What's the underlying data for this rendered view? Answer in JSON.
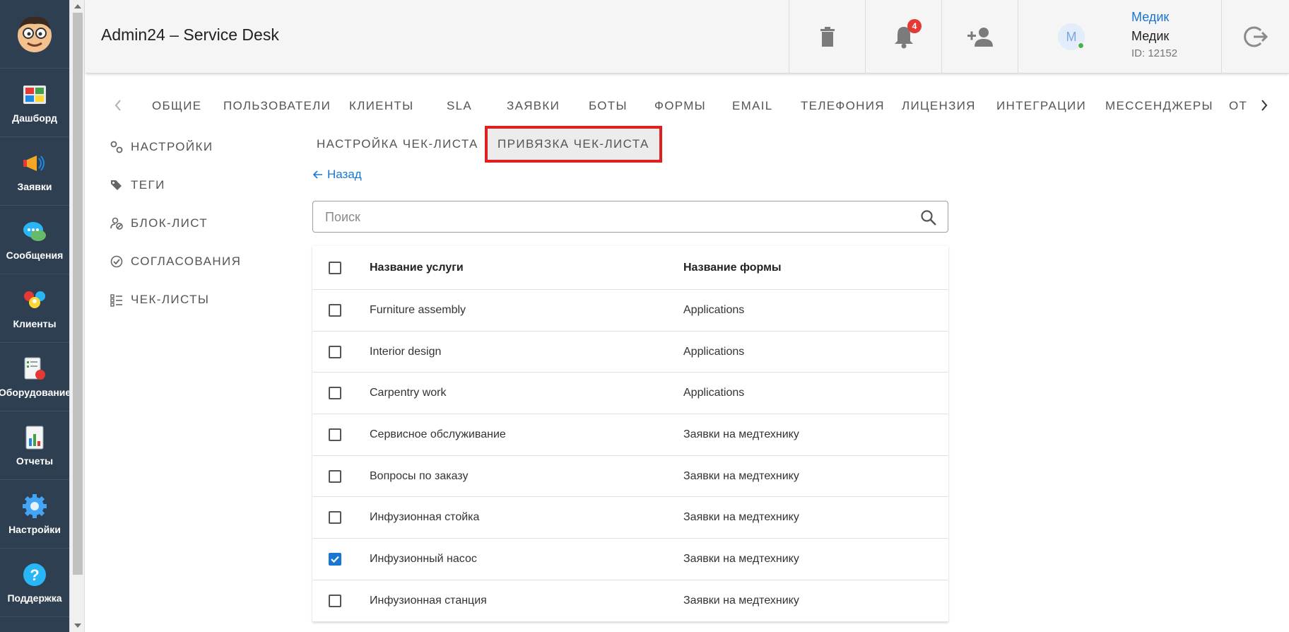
{
  "sidebar": {
    "logo": "avatar-logo",
    "items": [
      {
        "label": "Дашборд",
        "icon": "dashboard-icon"
      },
      {
        "label": "Заявки",
        "icon": "megaphone-icon"
      },
      {
        "label": "Сообщения",
        "icon": "chat-icon"
      },
      {
        "label": "Клиенты",
        "icon": "clients-icon"
      },
      {
        "label": "Оборудование",
        "icon": "equipment-icon"
      },
      {
        "label": "Отчеты",
        "icon": "reports-icon"
      },
      {
        "label": "Настройки",
        "icon": "gear-icon"
      },
      {
        "label": "Поддержка",
        "icon": "help-icon"
      }
    ]
  },
  "header": {
    "title": "Admin24 – Service Desk",
    "notifications_count": "4",
    "avatar_initial": "М",
    "user_link": "Медик",
    "user_name": "Медик",
    "user_id": "ID: 12152"
  },
  "top_tabs": [
    "ОБЩИЕ",
    "ПОЛЬЗОВАТЕЛИ",
    "КЛИЕНТЫ",
    "SLA",
    "ЗАЯВКИ",
    "БОТЫ",
    "ФОРМЫ",
    "EMAIL",
    "ТЕЛЕФОНИЯ",
    "ЛИЦЕНЗИЯ",
    "ИНТЕГРАЦИИ",
    "МЕССЕНДЖЕРЫ",
    "ОТ"
  ],
  "settings_nav": [
    {
      "label": "НАСТРОЙКИ",
      "icon": "settings-cog-icon"
    },
    {
      "label": "ТЕГИ",
      "icon": "tag-icon"
    },
    {
      "label": "БЛОК-ЛИСТ",
      "icon": "block-list-icon"
    },
    {
      "label": "СОГЛАСОВАНИЯ",
      "icon": "check-circle-icon"
    },
    {
      "label": "ЧЕК-ЛИСТЫ",
      "icon": "checklist-icon"
    }
  ],
  "inner_tabs": {
    "setup": "НАСТРОЙКА ЧЕК-ЛИСТА",
    "binding": "ПРИВЯЗКА ЧЕК-ЛИСТА"
  },
  "back_label": "Назад",
  "search": {
    "placeholder": "Поиск",
    "value": ""
  },
  "table": {
    "columns": [
      "Название услуги",
      "Название формы"
    ],
    "rows": [
      {
        "service": "Furniture assembly",
        "form": "Applications",
        "checked": false
      },
      {
        "service": "Interior design",
        "form": "Applications",
        "checked": false
      },
      {
        "service": "Carpentry work",
        "form": "Applications",
        "checked": false
      },
      {
        "service": "Сервисное обслуживание",
        "form": "Заявки на медтехнику",
        "checked": false
      },
      {
        "service": "Вопросы по заказу",
        "form": "Заявки на медтехнику",
        "checked": false
      },
      {
        "service": "Инфузионная стойка",
        "form": "Заявки на медтехнику",
        "checked": false
      },
      {
        "service": "Инфузионный насос",
        "form": "Заявки на медтехнику",
        "checked": true
      },
      {
        "service": "Инфузионная станция",
        "form": "Заявки на медтехнику",
        "checked": false
      }
    ]
  },
  "colors": {
    "sidebar": "#2f3f52",
    "accent": "#1976d2",
    "highlight_border": "#e02020",
    "badge": "#e53935"
  }
}
